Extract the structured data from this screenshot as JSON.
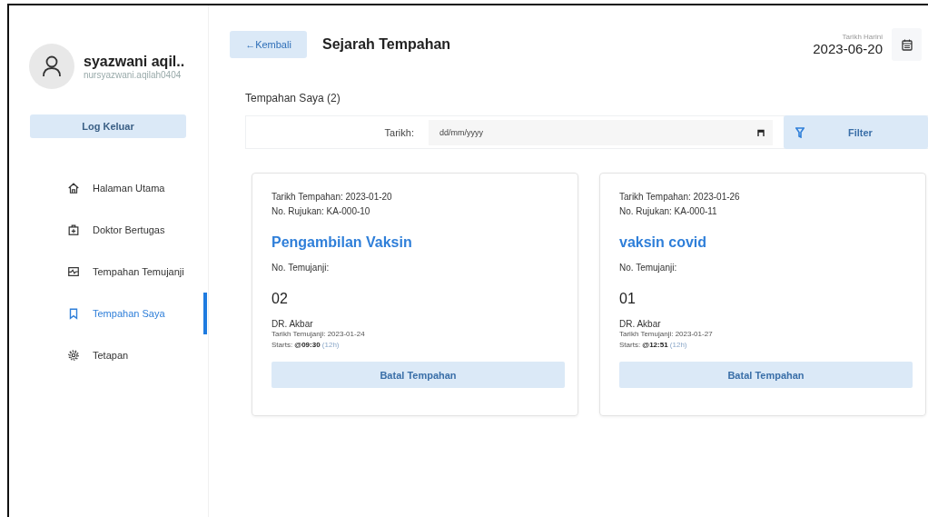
{
  "user": {
    "name": "syazwani aqil..",
    "email": "nursyazwani.aqilah0404"
  },
  "logout_button": "Log Keluar",
  "nav": [
    {
      "label": "Halaman Utama",
      "selected": false
    },
    {
      "label": "Doktor Bertugas",
      "selected": false
    },
    {
      "label": "Tempahan Temujanji",
      "selected": false
    },
    {
      "label": "Tempahan Saya",
      "selected": true
    },
    {
      "label": "Tetapan",
      "selected": false
    }
  ],
  "header": {
    "back_button": "←Kembali",
    "title": "Sejarah Tempahan",
    "today_label": "Tarikh Harini",
    "today_date": "2023-06-20"
  },
  "section_title": "Tempahan Saya (2)",
  "filter": {
    "date_label": "Tarikh:",
    "date_placeholder": "dd/mm/yyyy",
    "button": "Filter"
  },
  "bookings": [
    {
      "booking_date": "Tarikh Tempahan: 2023-01-20",
      "reference": "No. Rujukan: KA-000-10",
      "service": "Pengambilan Vaksin",
      "number_label": "No. Temujanji:",
      "number": "02",
      "doctor": "DR. Akbar",
      "appointment_date": "Tarikh Temujanji: 2023-01-24",
      "starts": "Starts: **@09:30**",
      "time_format": "(12h)",
      "cancel_button": "Batal Tempahan"
    },
    {
      "booking_date": "Tarikh Tempahan: 2023-01-26",
      "reference": "No. Rujukan: KA-000-11",
      "service": "vaksin covid",
      "number_label": "No. Temujanji:",
      "number": "01",
      "doctor": "DR. Akbar",
      "appointment_date": "Tarikh Temujanji: 2023-01-27",
      "starts": "Starts: **@12:51**",
      "time_format": "(12h)",
      "cancel_button": "Batal Tempahan"
    }
  ]
}
